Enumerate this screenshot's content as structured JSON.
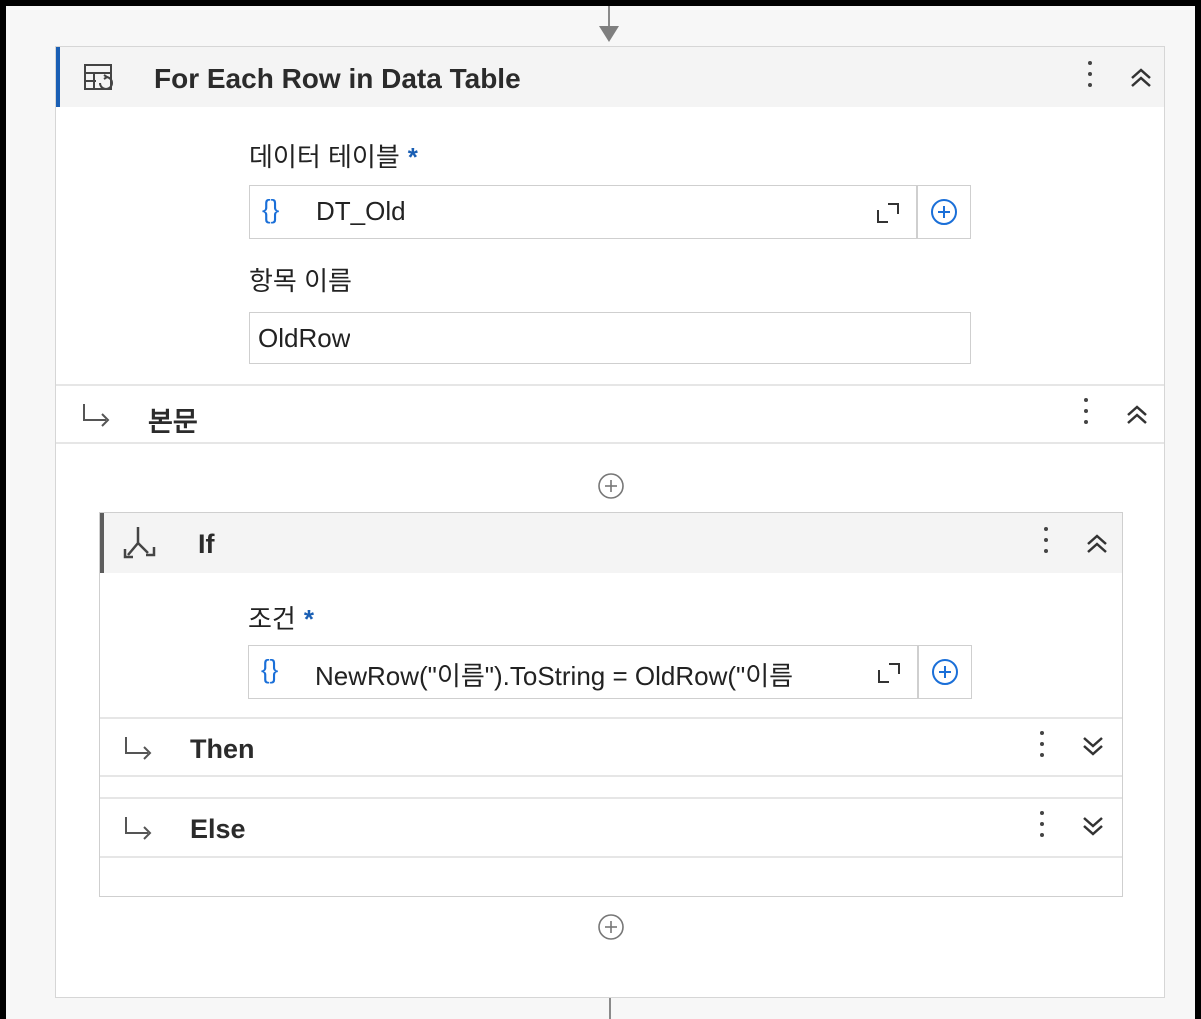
{
  "activity": {
    "title": "For Each Row in Data Table",
    "icon": "table-loop-icon",
    "fields": {
      "datatable_label": "데이터 테이블",
      "datatable_required": "*",
      "datatable_value": "DT_Old",
      "item_label": "항목 이름",
      "item_value": "OldRow"
    },
    "body_title": "본문"
  },
  "if_block": {
    "title": "If",
    "condition_label": "조건",
    "condition_required": "*",
    "condition_value": "NewRow(\"이름\").ToString = OldRow(\"이름",
    "then_label": "Then",
    "else_label": "Else"
  },
  "colors": {
    "accent": "#1a5fb4",
    "braces": "#1a6fd8",
    "header_bg": "#f4f4f4"
  },
  "icons": [
    "table-loop-icon",
    "more-vertical-icon",
    "collapse-double-chevron-up-icon",
    "expand-double-chevron-down-icon",
    "return-arrow-icon",
    "split-branch-icon",
    "add-circle-icon",
    "expand-editor-icon",
    "braces-icon"
  ]
}
